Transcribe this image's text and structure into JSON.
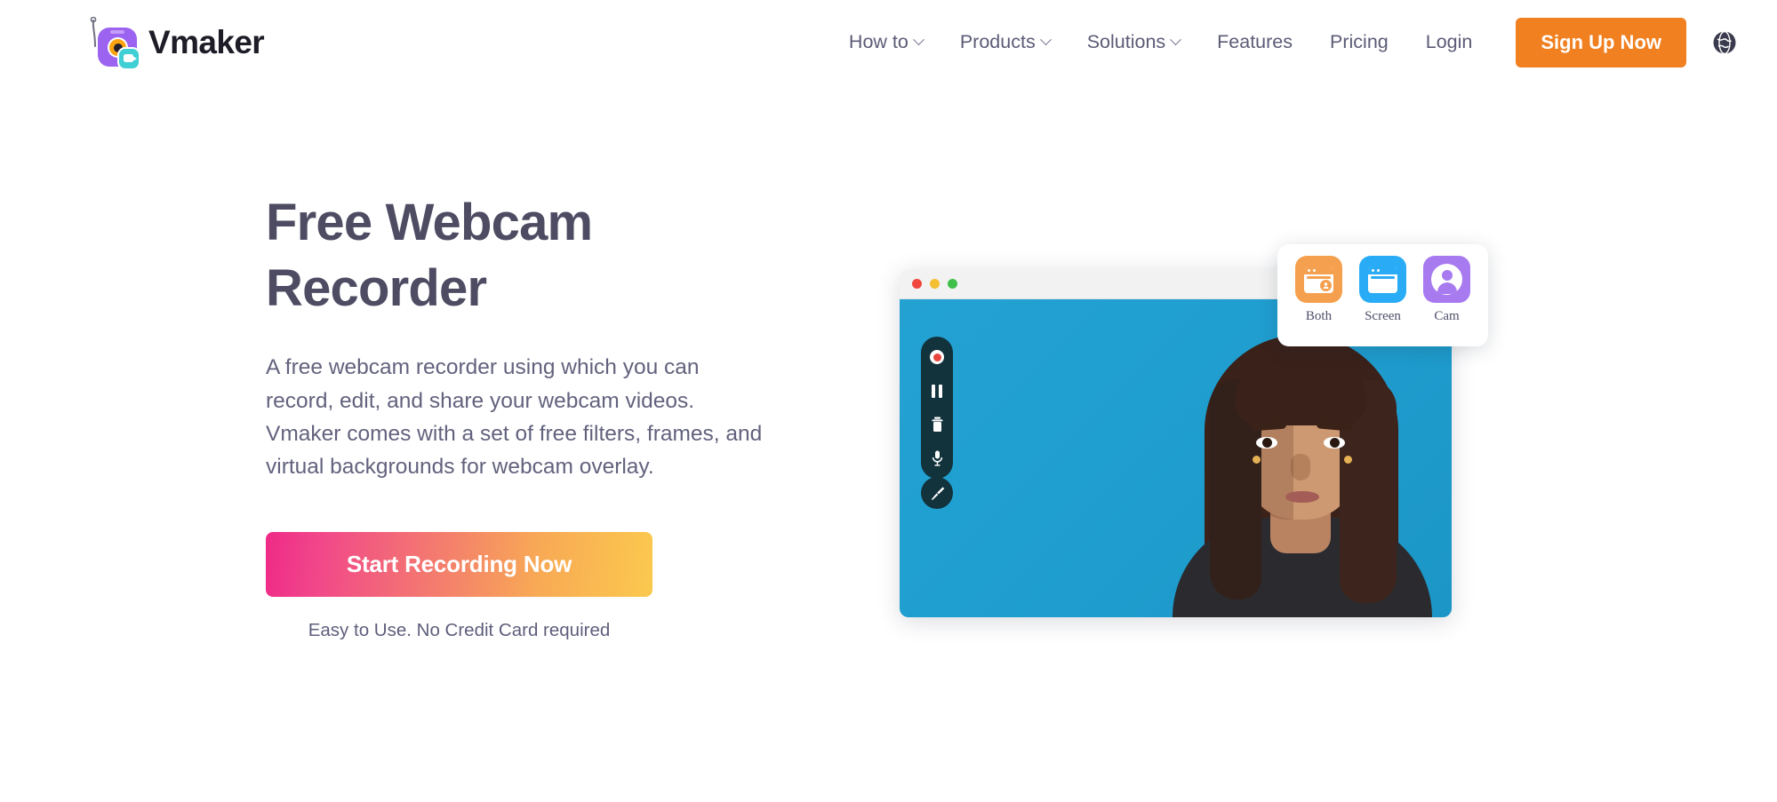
{
  "brand": {
    "name": "Vmaker",
    "logo_icon": "vmaker-camera-logo"
  },
  "nav": {
    "items": [
      {
        "label": "How to",
        "has_dropdown": true
      },
      {
        "label": "Products",
        "has_dropdown": true
      },
      {
        "label": "Solutions",
        "has_dropdown": true
      },
      {
        "label": "Features",
        "has_dropdown": false
      },
      {
        "label": "Pricing",
        "has_dropdown": false
      },
      {
        "label": "Login",
        "has_dropdown": false
      }
    ],
    "signup_label": "Sign Up Now",
    "language_icon": "globe-icon"
  },
  "hero": {
    "title_line1": "Free Webcam",
    "title_line2": "Recorder",
    "description": "A free webcam recorder using which you can record, edit, and share your webcam videos. Vmaker comes with a set of free filters, frames, and virtual backgrounds for webcam overlay.",
    "cta_label": "Start Recording Now",
    "cta_note": "Easy to Use. No Credit Card required"
  },
  "preview": {
    "window_dots": [
      "red",
      "yellow",
      "green"
    ],
    "controls": [
      {
        "name": "record",
        "icon": "record-dot-icon"
      },
      {
        "name": "pause",
        "icon": "pause-icon"
      },
      {
        "name": "delete",
        "icon": "trash-icon"
      },
      {
        "name": "microphone",
        "icon": "microphone-icon"
      }
    ],
    "annotate": {
      "name": "annotate",
      "icon": "brush-icon"
    }
  },
  "mode_selector": {
    "options": [
      {
        "label": "Both",
        "icon": "window-with-avatar-icon",
        "color": "#F5A04F"
      },
      {
        "label": "Screen",
        "icon": "window-icon",
        "color": "#29ACF5"
      },
      {
        "label": "Cam",
        "icon": "person-avatar-icon",
        "color": "#A77AF0"
      }
    ]
  },
  "colors": {
    "brand_orange": "#F08020",
    "heading": "#4D4C63",
    "body_text": "#62627E",
    "cta_gradient_start": "#EF2A87",
    "cta_gradient_end": "#FBC94E",
    "video_blue": "#1F9FD0",
    "toolbar_dark": "#12323C"
  }
}
